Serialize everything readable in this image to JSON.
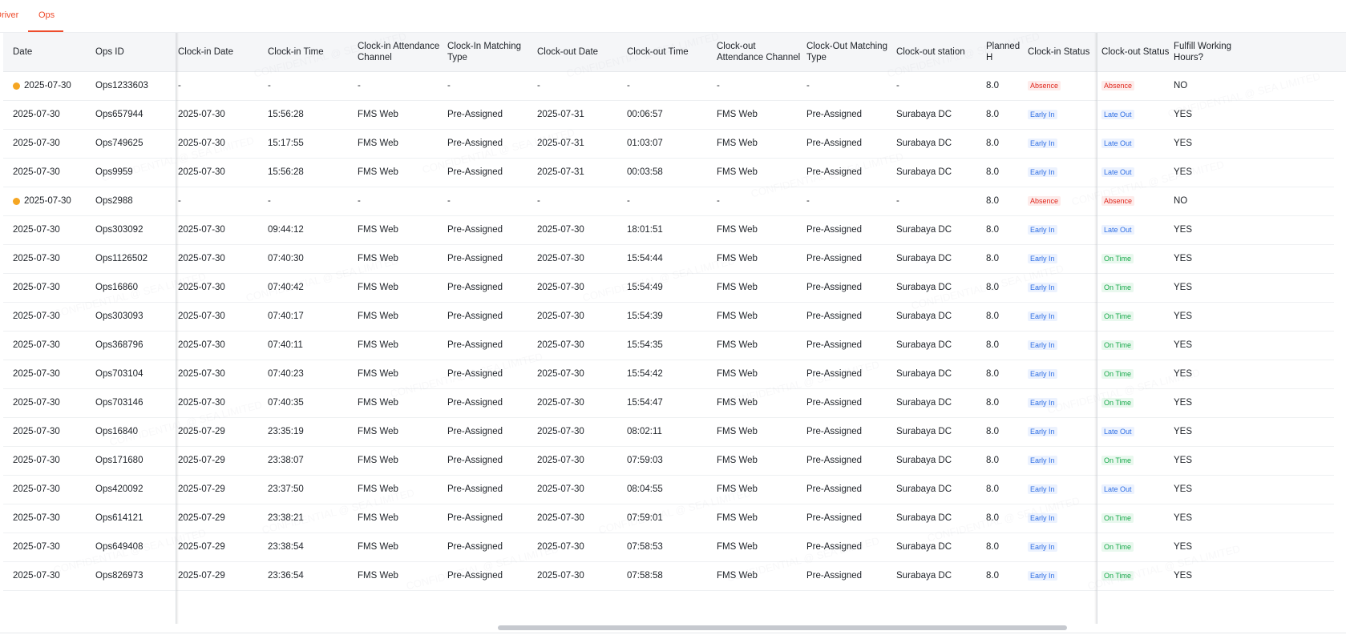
{
  "tabs": {
    "driver": "Driver",
    "ops": "Ops"
  },
  "columns": [
    "Date",
    "Ops ID",
    "Clock-in Date",
    "Clock-in Time",
    "Clock-in Attendance Channel",
    "Clock-In Matching Type",
    "Clock-out Date",
    "Clock-out Time",
    "Clock-out Attendance Channel",
    "Clock-Out Matching Type",
    "Clock-out station",
    "Planned H",
    "Clock-in Status",
    "Clock-out Status",
    "Fulfill Working Hours?"
  ],
  "colors": {
    "accent": "#ee4d2d",
    "absence": "#e0281e",
    "early_in": "#2f6fe4",
    "on_time": "#17a94a",
    "warning_dot": "#f5a623"
  },
  "rows": [
    [
      "2025-07-30",
      "Ops1233603",
      "-",
      "-",
      "-",
      "-",
      "-",
      "-",
      "-",
      "-",
      "-",
      "8.0",
      "Absence",
      "Absence",
      "NO"
    ],
    [
      "2025-07-30",
      "Ops657944",
      "2025-07-30",
      "15:56:28",
      "FMS Web",
      "Pre-Assigned",
      "2025-07-31",
      "00:06:57",
      "FMS Web",
      "Pre-Assigned",
      "Surabaya DC",
      "8.0",
      "Early In",
      "Late Out",
      "YES"
    ],
    [
      "2025-07-30",
      "Ops749625",
      "2025-07-30",
      "15:17:55",
      "FMS Web",
      "Pre-Assigned",
      "2025-07-31",
      "01:03:07",
      "FMS Web",
      "Pre-Assigned",
      "Surabaya DC",
      "8.0",
      "Early In",
      "Late Out",
      "YES"
    ],
    [
      "2025-07-30",
      "Ops9959",
      "2025-07-30",
      "15:56:28",
      "FMS Web",
      "Pre-Assigned",
      "2025-07-31",
      "00:03:58",
      "FMS Web",
      "Pre-Assigned",
      "Surabaya DC",
      "8.0",
      "Early In",
      "Late Out",
      "YES"
    ],
    [
      "2025-07-30",
      "Ops2988",
      "-",
      "-",
      "-",
      "-",
      "-",
      "-",
      "-",
      "-",
      "-",
      "8.0",
      "Absence",
      "Absence",
      "NO"
    ],
    [
      "2025-07-30",
      "Ops303092",
      "2025-07-30",
      "09:44:12",
      "FMS Web",
      "Pre-Assigned",
      "2025-07-30",
      "18:01:51",
      "FMS Web",
      "Pre-Assigned",
      "Surabaya DC",
      "8.0",
      "Early In",
      "Late Out",
      "YES"
    ],
    [
      "2025-07-30",
      "Ops1126502",
      "2025-07-30",
      "07:40:30",
      "FMS Web",
      "Pre-Assigned",
      "2025-07-30",
      "15:54:44",
      "FMS Web",
      "Pre-Assigned",
      "Surabaya DC",
      "8.0",
      "Early In",
      "On Time",
      "YES"
    ],
    [
      "2025-07-30",
      "Ops16860",
      "2025-07-30",
      "07:40:42",
      "FMS Web",
      "Pre-Assigned",
      "2025-07-30",
      "15:54:49",
      "FMS Web",
      "Pre-Assigned",
      "Surabaya DC",
      "8.0",
      "Early In",
      "On Time",
      "YES"
    ],
    [
      "2025-07-30",
      "Ops303093",
      "2025-07-30",
      "07:40:17",
      "FMS Web",
      "Pre-Assigned",
      "2025-07-30",
      "15:54:39",
      "FMS Web",
      "Pre-Assigned",
      "Surabaya DC",
      "8.0",
      "Early In",
      "On Time",
      "YES"
    ],
    [
      "2025-07-30",
      "Ops368796",
      "2025-07-30",
      "07:40:11",
      "FMS Web",
      "Pre-Assigned",
      "2025-07-30",
      "15:54:35",
      "FMS Web",
      "Pre-Assigned",
      "Surabaya DC",
      "8.0",
      "Early In",
      "On Time",
      "YES"
    ],
    [
      "2025-07-30",
      "Ops703104",
      "2025-07-30",
      "07:40:23",
      "FMS Web",
      "Pre-Assigned",
      "2025-07-30",
      "15:54:42",
      "FMS Web",
      "Pre-Assigned",
      "Surabaya DC",
      "8.0",
      "Early In",
      "On Time",
      "YES"
    ],
    [
      "2025-07-30",
      "Ops703146",
      "2025-07-30",
      "07:40:35",
      "FMS Web",
      "Pre-Assigned",
      "2025-07-30",
      "15:54:47",
      "FMS Web",
      "Pre-Assigned",
      "Surabaya DC",
      "8.0",
      "Early In",
      "On Time",
      "YES"
    ],
    [
      "2025-07-30",
      "Ops16840",
      "2025-07-29",
      "23:35:19",
      "FMS Web",
      "Pre-Assigned",
      "2025-07-30",
      "08:02:11",
      "FMS Web",
      "Pre-Assigned",
      "Surabaya DC",
      "8.0",
      "Early In",
      "Late Out",
      "YES"
    ],
    [
      "2025-07-30",
      "Ops171680",
      "2025-07-29",
      "23:38:07",
      "FMS Web",
      "Pre-Assigned",
      "2025-07-30",
      "07:59:03",
      "FMS Web",
      "Pre-Assigned",
      "Surabaya DC",
      "8.0",
      "Early In",
      "On Time",
      "YES"
    ],
    [
      "2025-07-30",
      "Ops420092",
      "2025-07-29",
      "23:37:50",
      "FMS Web",
      "Pre-Assigned",
      "2025-07-30",
      "08:04:55",
      "FMS Web",
      "Pre-Assigned",
      "Surabaya DC",
      "8.0",
      "Early In",
      "Late Out",
      "YES"
    ],
    [
      "2025-07-30",
      "Ops614121",
      "2025-07-29",
      "23:38:21",
      "FMS Web",
      "Pre-Assigned",
      "2025-07-30",
      "07:59:01",
      "FMS Web",
      "Pre-Assigned",
      "Surabaya DC",
      "8.0",
      "Early In",
      "On Time",
      "YES"
    ],
    [
      "2025-07-30",
      "Ops649408",
      "2025-07-29",
      "23:38:54",
      "FMS Web",
      "Pre-Assigned",
      "2025-07-30",
      "07:58:53",
      "FMS Web",
      "Pre-Assigned",
      "Surabaya DC",
      "8.0",
      "Early In",
      "On Time",
      "YES"
    ],
    [
      "2025-07-30",
      "Ops826973",
      "2025-07-29",
      "23:36:54",
      "FMS Web",
      "Pre-Assigned",
      "2025-07-30",
      "07:58:58",
      "FMS Web",
      "Pre-Assigned",
      "Surabaya DC",
      "8.0",
      "Early In",
      "On Time",
      "YES"
    ]
  ],
  "watermark": "CONFIDENTIAL @ SEA LIMITED"
}
